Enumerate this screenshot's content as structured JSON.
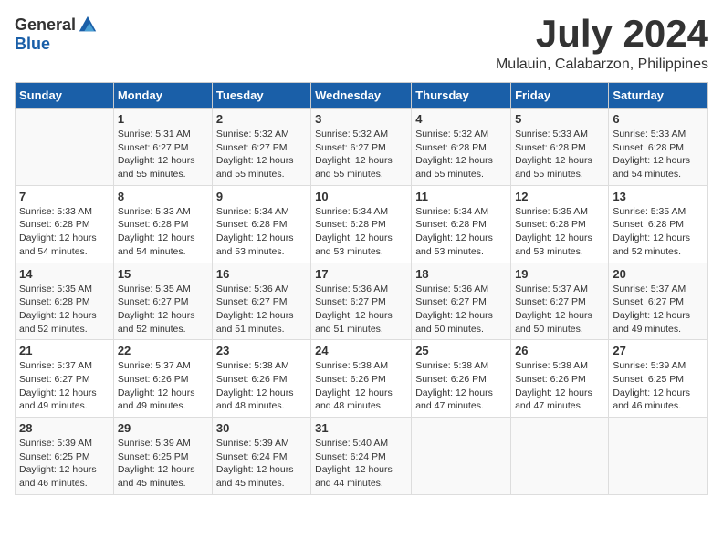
{
  "header": {
    "logo_general": "General",
    "logo_blue": "Blue",
    "month_year": "July 2024",
    "location": "Mulauin, Calabarzon, Philippines"
  },
  "calendar": {
    "days_of_week": [
      "Sunday",
      "Monday",
      "Tuesday",
      "Wednesday",
      "Thursday",
      "Friday",
      "Saturday"
    ],
    "weeks": [
      [
        {
          "day": "",
          "info": ""
        },
        {
          "day": "1",
          "info": "Sunrise: 5:31 AM\nSunset: 6:27 PM\nDaylight: 12 hours\nand 55 minutes."
        },
        {
          "day": "2",
          "info": "Sunrise: 5:32 AM\nSunset: 6:27 PM\nDaylight: 12 hours\nand 55 minutes."
        },
        {
          "day": "3",
          "info": "Sunrise: 5:32 AM\nSunset: 6:27 PM\nDaylight: 12 hours\nand 55 minutes."
        },
        {
          "day": "4",
          "info": "Sunrise: 5:32 AM\nSunset: 6:28 PM\nDaylight: 12 hours\nand 55 minutes."
        },
        {
          "day": "5",
          "info": "Sunrise: 5:33 AM\nSunset: 6:28 PM\nDaylight: 12 hours\nand 55 minutes."
        },
        {
          "day": "6",
          "info": "Sunrise: 5:33 AM\nSunset: 6:28 PM\nDaylight: 12 hours\nand 54 minutes."
        }
      ],
      [
        {
          "day": "7",
          "info": "Sunrise: 5:33 AM\nSunset: 6:28 PM\nDaylight: 12 hours\nand 54 minutes."
        },
        {
          "day": "8",
          "info": "Sunrise: 5:33 AM\nSunset: 6:28 PM\nDaylight: 12 hours\nand 54 minutes."
        },
        {
          "day": "9",
          "info": "Sunrise: 5:34 AM\nSunset: 6:28 PM\nDaylight: 12 hours\nand 53 minutes."
        },
        {
          "day": "10",
          "info": "Sunrise: 5:34 AM\nSunset: 6:28 PM\nDaylight: 12 hours\nand 53 minutes."
        },
        {
          "day": "11",
          "info": "Sunrise: 5:34 AM\nSunset: 6:28 PM\nDaylight: 12 hours\nand 53 minutes."
        },
        {
          "day": "12",
          "info": "Sunrise: 5:35 AM\nSunset: 6:28 PM\nDaylight: 12 hours\nand 53 minutes."
        },
        {
          "day": "13",
          "info": "Sunrise: 5:35 AM\nSunset: 6:28 PM\nDaylight: 12 hours\nand 52 minutes."
        }
      ],
      [
        {
          "day": "14",
          "info": "Sunrise: 5:35 AM\nSunset: 6:28 PM\nDaylight: 12 hours\nand 52 minutes."
        },
        {
          "day": "15",
          "info": "Sunrise: 5:35 AM\nSunset: 6:27 PM\nDaylight: 12 hours\nand 52 minutes."
        },
        {
          "day": "16",
          "info": "Sunrise: 5:36 AM\nSunset: 6:27 PM\nDaylight: 12 hours\nand 51 minutes."
        },
        {
          "day": "17",
          "info": "Sunrise: 5:36 AM\nSunset: 6:27 PM\nDaylight: 12 hours\nand 51 minutes."
        },
        {
          "day": "18",
          "info": "Sunrise: 5:36 AM\nSunset: 6:27 PM\nDaylight: 12 hours\nand 50 minutes."
        },
        {
          "day": "19",
          "info": "Sunrise: 5:37 AM\nSunset: 6:27 PM\nDaylight: 12 hours\nand 50 minutes."
        },
        {
          "day": "20",
          "info": "Sunrise: 5:37 AM\nSunset: 6:27 PM\nDaylight: 12 hours\nand 49 minutes."
        }
      ],
      [
        {
          "day": "21",
          "info": "Sunrise: 5:37 AM\nSunset: 6:27 PM\nDaylight: 12 hours\nand 49 minutes."
        },
        {
          "day": "22",
          "info": "Sunrise: 5:37 AM\nSunset: 6:26 PM\nDaylight: 12 hours\nand 49 minutes."
        },
        {
          "day": "23",
          "info": "Sunrise: 5:38 AM\nSunset: 6:26 PM\nDaylight: 12 hours\nand 48 minutes."
        },
        {
          "day": "24",
          "info": "Sunrise: 5:38 AM\nSunset: 6:26 PM\nDaylight: 12 hours\nand 48 minutes."
        },
        {
          "day": "25",
          "info": "Sunrise: 5:38 AM\nSunset: 6:26 PM\nDaylight: 12 hours\nand 47 minutes."
        },
        {
          "day": "26",
          "info": "Sunrise: 5:38 AM\nSunset: 6:26 PM\nDaylight: 12 hours\nand 47 minutes."
        },
        {
          "day": "27",
          "info": "Sunrise: 5:39 AM\nSunset: 6:25 PM\nDaylight: 12 hours\nand 46 minutes."
        }
      ],
      [
        {
          "day": "28",
          "info": "Sunrise: 5:39 AM\nSunset: 6:25 PM\nDaylight: 12 hours\nand 46 minutes."
        },
        {
          "day": "29",
          "info": "Sunrise: 5:39 AM\nSunset: 6:25 PM\nDaylight: 12 hours\nand 45 minutes."
        },
        {
          "day": "30",
          "info": "Sunrise: 5:39 AM\nSunset: 6:24 PM\nDaylight: 12 hours\nand 45 minutes."
        },
        {
          "day": "31",
          "info": "Sunrise: 5:40 AM\nSunset: 6:24 PM\nDaylight: 12 hours\nand 44 minutes."
        },
        {
          "day": "",
          "info": ""
        },
        {
          "day": "",
          "info": ""
        },
        {
          "day": "",
          "info": ""
        }
      ]
    ]
  }
}
